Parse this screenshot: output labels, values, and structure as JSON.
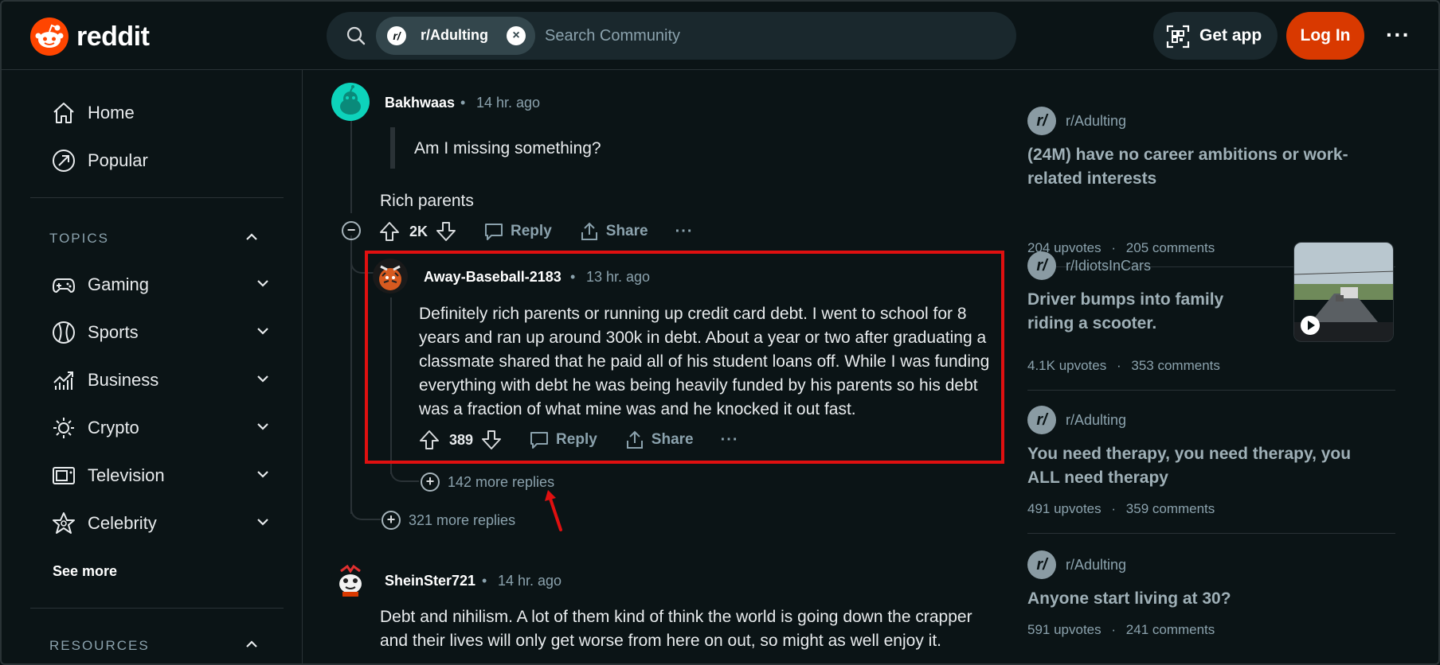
{
  "header": {
    "logo_text": "reddit",
    "search_chip": "r/Adulting",
    "search_placeholder": "Search Community",
    "get_app": "Get app",
    "login": "Log In",
    "more": "···"
  },
  "sidebar": {
    "nav": [
      {
        "label": "Home",
        "icon": "home-icon"
      },
      {
        "label": "Popular",
        "icon": "popular-icon"
      }
    ],
    "topics_title": "TOPICS",
    "topics": [
      {
        "label": "Gaming",
        "icon": "gamepad-icon"
      },
      {
        "label": "Sports",
        "icon": "ball-icon"
      },
      {
        "label": "Business",
        "icon": "chart-icon"
      },
      {
        "label": "Crypto",
        "icon": "crypto-icon"
      },
      {
        "label": "Television",
        "icon": "tv-icon"
      },
      {
        "label": "Celebrity",
        "icon": "star-icon"
      }
    ],
    "see_more": "See more",
    "resources_title": "RESOURCES"
  },
  "comments": {
    "c1": {
      "username": "Bakhwaas",
      "time": "14 hr. ago",
      "quote": "Am I missing something?",
      "body": "Rich parents",
      "votes": "2K",
      "reply": "Reply",
      "share": "Share"
    },
    "c2": {
      "username": "Away-Baseball-2183",
      "time": "13 hr. ago",
      "body": "Definitely rich parents or running up credit card debt. I went to school for 8 years and ran up around 300k in debt. About a year or two after graduating a classmate shared that he paid all of his student loans off. While I was funding everything with debt he was being heavily funded by his parents so his debt was a fraction of what mine was and he knocked it out fast.",
      "votes": "389",
      "reply": "Reply",
      "share": "Share",
      "more_replies": "142 more replies"
    },
    "c1_more_replies": "321 more replies",
    "c3": {
      "username": "SheinSter721",
      "time": "14 hr. ago",
      "body": "Debt and nihilism. A lot of them kind of think the world is going down the crapper and their lives will only get worse from here on out, so might as well enjoy it."
    },
    "separator": "•"
  },
  "related": [
    {
      "sub": "r/Adulting",
      "title": "(24M) have no career ambitions or work-related interests",
      "upvotes": "204 upvotes",
      "comments": "205 comments"
    },
    {
      "sub": "r/IdiotsInCars",
      "title": "Driver bumps into family riding a scooter.",
      "upvotes": "4.1K upvotes",
      "comments": "353 comments"
    },
    {
      "sub": "r/Adulting",
      "title": "You need therapy, you need therapy, you ALL need therapy",
      "upvotes": "491 upvotes",
      "comments": "359 comments"
    },
    {
      "sub": "r/Adulting",
      "title": "Anyone start living at 30?",
      "upvotes": "591 upvotes",
      "comments": "241 comments"
    }
  ],
  "stats_sep": "·",
  "colors": {
    "brand": "#ff4500",
    "login": "#d93900",
    "highlight": "#e01010",
    "bg": "#0b1416"
  }
}
